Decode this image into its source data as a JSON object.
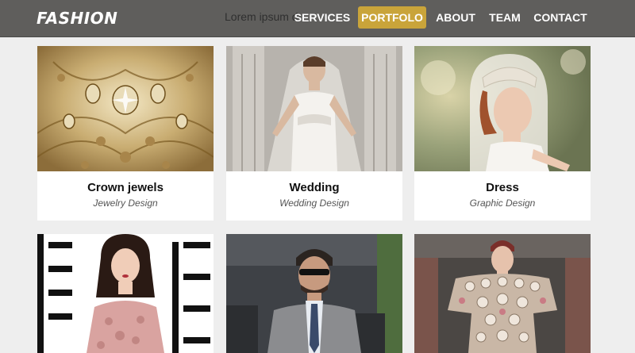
{
  "header": {
    "brand": "FASHION",
    "tagline": "Lorem ipsum dolor sit amet",
    "nav": [
      {
        "label": "SERVICES",
        "active": false
      },
      {
        "label": "PORTFOLO",
        "active": true
      },
      {
        "label": "ABOUT",
        "active": false
      },
      {
        "label": "TEAM",
        "active": false
      },
      {
        "label": "CONTACT",
        "active": false
      }
    ],
    "accent_color": "#c9a43a",
    "bar_color": "#5f5e5c"
  },
  "portfolio": {
    "items": [
      {
        "title": "Crown jewels",
        "subtitle": "Jewelry Design",
        "image": "ornate-gold-jewelry-photo"
      },
      {
        "title": "Wedding",
        "subtitle": "Wedding Design",
        "image": "bride-in-veil-photo"
      },
      {
        "title": "Dress",
        "subtitle": "Graphic Design",
        "image": "bride-in-lace-cap-photo"
      },
      {
        "image": "woman-in-pink-gown-photo"
      },
      {
        "image": "man-in-suit-sunglasses-photo"
      },
      {
        "image": "embellished-runway-gown-photo"
      }
    ]
  }
}
